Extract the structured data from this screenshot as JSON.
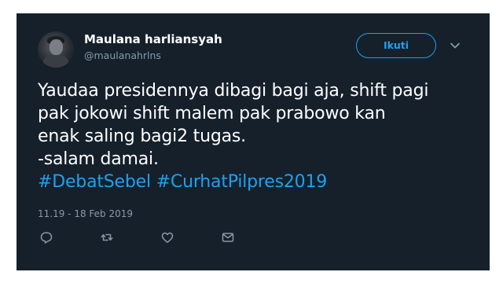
{
  "tweet": {
    "author": {
      "display_name": "Maulana harliansyah",
      "handle": "@maulanahrlns"
    },
    "follow_label": "Ikuti",
    "text_lines": [
      "Yaudaa presidennya dibagi bagi aja, shift pagi",
      "pak jokowi shift malem pak prabowo kan",
      "enak saling bagi2 tugas.",
      "-salam damai."
    ],
    "hashtags": [
      "#DebatSebel",
      "#CurhatPilpres2019"
    ],
    "timestamp": "11.19 - 18 Feb 2019"
  },
  "actions": [
    {
      "icon": "reply-icon"
    },
    {
      "icon": "retweet-icon"
    },
    {
      "icon": "like-icon"
    },
    {
      "icon": "direct-message-icon"
    }
  ],
  "colors": {
    "background": "#15202b",
    "accent": "#1da1f2",
    "secondary_text": "#8899a6",
    "primary_text": "#ffffff"
  }
}
